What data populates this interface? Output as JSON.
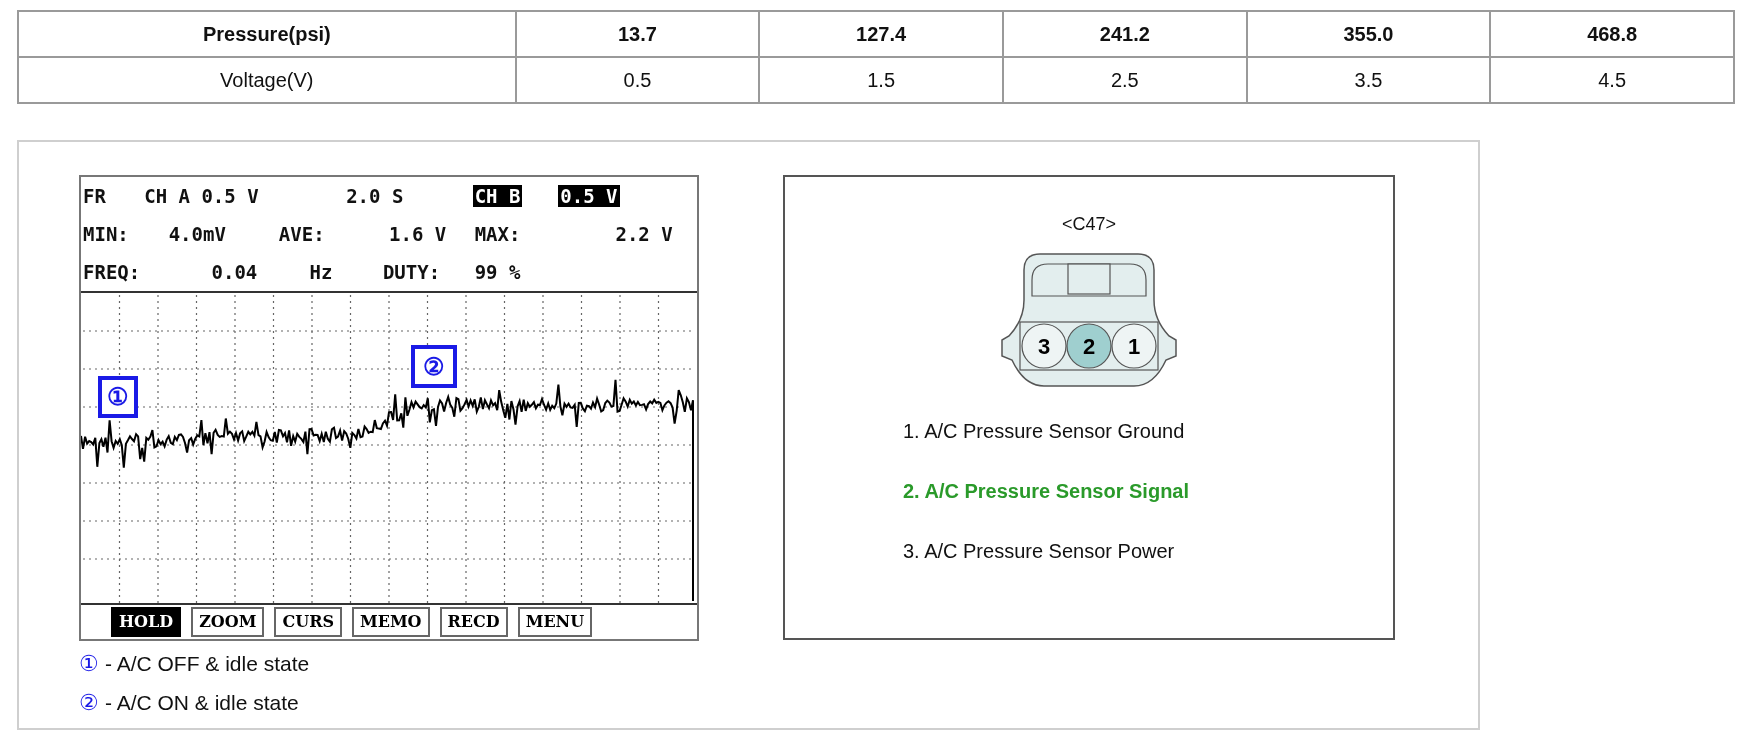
{
  "table": {
    "rows": [
      {
        "header": true,
        "cells": [
          "Pressure(psi)",
          "13.7",
          "127.4",
          "241.2",
          "355.0",
          "468.8"
        ]
      },
      {
        "header": false,
        "cells": [
          "Voltage(V)",
          "0.5",
          "1.5",
          "2.5",
          "3.5",
          "4.5"
        ]
      }
    ]
  },
  "scope": {
    "header_lines": [
      [
        {
          "text": "FR",
          "inverted": false
        },
        {
          "text": "CH A 0.5 V",
          "inverted": false
        },
        {
          "text": "2.0 S",
          "inverted": false
        },
        {
          "text": "CH B",
          "inverted": true
        },
        {
          "text": "0.5 V",
          "inverted": true
        }
      ],
      [
        {
          "text": "MIN:",
          "inverted": false
        },
        {
          "text": "4.0mV",
          "inverted": false
        },
        {
          "text": "AVE:",
          "inverted": false
        },
        {
          "text": "1.6 V",
          "inverted": false
        },
        {
          "text": "MAX:",
          "inverted": false
        },
        {
          "text": "2.2 V",
          "inverted": false
        }
      ],
      [
        {
          "text": "FREQ:",
          "inverted": false
        },
        {
          "text": "0.04",
          "inverted": false
        },
        {
          "text": "Hz",
          "inverted": false
        },
        {
          "text": "DUTY:",
          "inverted": false
        },
        {
          "text": "99 %",
          "inverted": false
        }
      ]
    ],
    "markers": [
      "①",
      "②"
    ],
    "buttons": [
      {
        "label": "HOLD",
        "selected": true
      },
      {
        "label": "ZOOM",
        "selected": false
      },
      {
        "label": "CURS",
        "selected": false
      },
      {
        "label": "MEMO",
        "selected": false
      },
      {
        "label": "RECD",
        "selected": false
      },
      {
        "label": "MENU",
        "selected": false
      }
    ]
  },
  "legend": [
    {
      "marker": "①",
      "text": "- A/C OFF & idle state"
    },
    {
      "marker": "②",
      "text": "- A/C ON & idle state"
    }
  ],
  "connector": {
    "title": "<C47>",
    "pins": [
      {
        "label": "3",
        "selected": false
      },
      {
        "label": "2",
        "selected": true
      },
      {
        "label": "1",
        "selected": false
      }
    ],
    "pinout": [
      {
        "text": "1. A/C Pressure Sensor Ground",
        "selected": false
      },
      {
        "text": "2. A/C Pressure Sensor Signal",
        "selected": true
      },
      {
        "text": "3. A/C Pressure Sensor Power",
        "selected": false
      }
    ]
  }
}
